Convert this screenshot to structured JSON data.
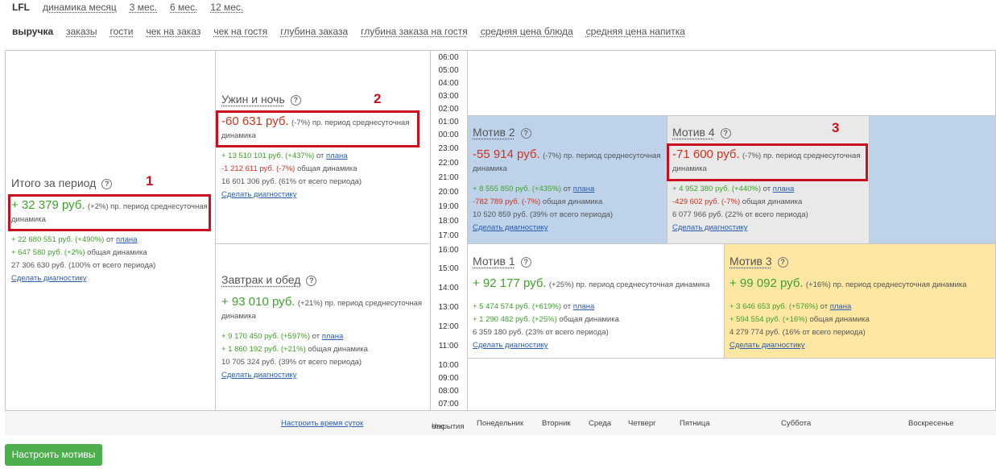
{
  "nav1": {
    "active": "LFL",
    "links": [
      "динамика месяц",
      "3 мес.",
      "6 мес.",
      "12 мес."
    ]
  },
  "nav2": {
    "active": "выручка",
    "links": [
      "заказы",
      "гости",
      "чек на заказ",
      "чек на гостя",
      "глубина заказа",
      "глубина заказа на гостя",
      "средняя цена блюда",
      "средняя цена напитка"
    ]
  },
  "total": {
    "title": "Итого за период",
    "value": "+ 32 379 руб.",
    "pct": "(+2%) пр. период среднесуточная",
    "tail": "динамика",
    "l1a": "+ 22 680 551 руб. (+490%)",
    "l1b": " от ",
    "l1c": "плана",
    "l2": "+ 647 580 руб. (+2%)",
    "l2b": " общая динамика",
    "l3": "27 306 630 руб. (100% от всего периода)",
    "diag": "Сделать диагностику",
    "marker": "1"
  },
  "dinner": {
    "title": "Ужин и ночь",
    "value": "-60 631 руб.",
    "pct": "(-7%) пр. период среднесуточная",
    "tail": "динамика",
    "l1a": "+ 13 510 101 руб. (+437%)",
    "l1b": " от ",
    "l1c": "плана",
    "l2": "-1 212 611 руб. (-7%)",
    "l2b": " общая динамика",
    "l3": "16 601 306 руб. (61% от всего периода)",
    "diag": "Сделать диагностику",
    "marker": "2"
  },
  "breakfast": {
    "title": "Завтрак и обед",
    "value": "+ 93 010 руб.",
    "pct": "(+21%) пр. период среднесуточная",
    "tail": "динамика",
    "l1a": "+ 9 170 450 руб. (+597%)",
    "l1b": " от ",
    "l1c": "плана",
    "l2": "+ 1 860 192 руб. (+21%)",
    "l2b": " общая динамика",
    "l3": "10 705 324 руб. (39% от всего периода)",
    "diag": "Сделать диагностику"
  },
  "motiv2": {
    "title": "Мотив 2",
    "value": "-55 914 руб.",
    "pct": "(-7%) пр. период среднесуточная",
    "tail": "динамика",
    "l1a": "+ 8 555 850 руб. (+435%)",
    "l1b": " от ",
    "l1c": "плана",
    "l2": "-782 789 руб. (-7%)",
    "l2b": " общая динамика",
    "l3": "10 520 859 руб. (39% от всего периода)",
    "diag": "Сделать диагностику"
  },
  "motiv4": {
    "title": "Мотив 4",
    "value": "-71 600 руб.",
    "pct": "(-7%) пр. период среднесуточная",
    "tail": "динамика",
    "l1a": "+ 4 952 380 руб. (+440%)",
    "l1b": " от ",
    "l1c": "плана",
    "l2": "-429 602 руб. (-7%)",
    "l2b": " общая динамика",
    "l3": "6 077 966 руб. (22% от всего периода)",
    "diag": "Сделать диагностику",
    "marker": "3"
  },
  "motiv1": {
    "title": "Мотив 1",
    "value": "+ 92 177 руб.",
    "pct": "(+25%) пр. период среднесуточная динамика",
    "l1a": "+ 5 474 574 руб. (+619%)",
    "l1b": " от ",
    "l1c": "плана",
    "l2": "+ 1 290 482 руб. (+25%)",
    "l2b": " общая динамика",
    "l3": "6 359 180 руб. (23% от всего периода)",
    "diag": "Сделать диагностику"
  },
  "motiv3": {
    "title": "Мотив 3",
    "value": "+ 99 092 руб.",
    "pct": "(+16%) пр. период среднесуточная динамика",
    "l1a": "+ 3 646 653 руб. (+576%)",
    "l1b": " от ",
    "l1c": "плана",
    "l2": "+ 594 554 руб. (+16%)",
    "l2b": " общая динамика",
    "l3": "4 279 774 руб. (16% от всего периода)",
    "diag": "Сделать диагностику"
  },
  "times": [
    "06:00",
    "05:00",
    "04:00",
    "03:00",
    "02:00",
    "01:00",
    "00:00",
    "23:00",
    "22:00",
    "21:00",
    "20:00",
    "19:00",
    "18:00",
    "17:00",
    "16:00",
    "15:00",
    "14:00",
    "13:00",
    "12:00",
    "11:00",
    "10:00",
    "09:00",
    "08:00",
    "07:00"
  ],
  "footer": {
    "configure_time": "Настроить время суток",
    "open_hour_1": "Час",
    "open_hour_2": "открытия",
    "days": [
      "Понедельник",
      "Вторник",
      "Среда",
      "Четверг",
      "Пятница",
      "Суббота",
      "Воскресенье"
    ]
  },
  "button": "Настроить мотивы",
  "colors": {
    "positive": "#3fa22b",
    "negative": "#d0321e",
    "blue_cell": "#bed3ea",
    "grey_cell": "#e9e9e9",
    "yellow_cell": "#fde7a2",
    "marker": "#c8101e",
    "button": "#4cae4c"
  }
}
